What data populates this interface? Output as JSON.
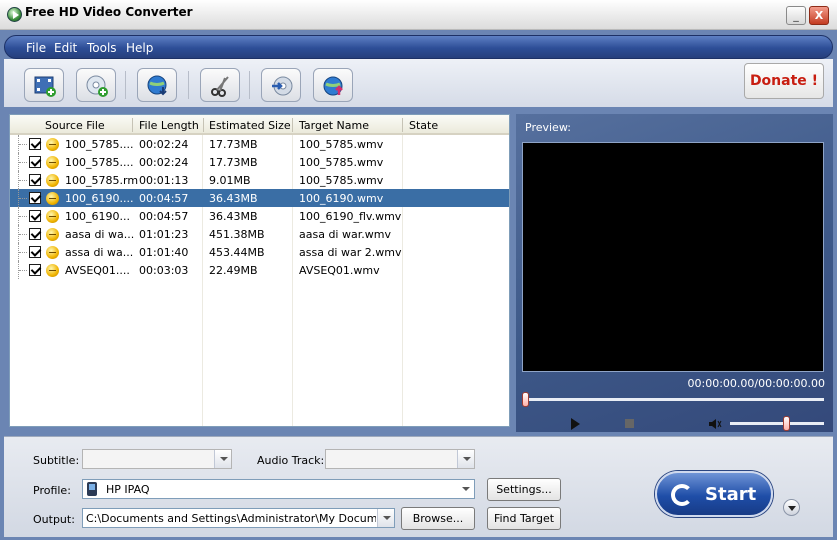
{
  "window": {
    "title": "Free HD Video Converter",
    "minimize": "_",
    "close": "X"
  },
  "menu": {
    "items": [
      "File",
      "Edit",
      "Tools",
      "Help"
    ]
  },
  "toolbar": {
    "buttons": [
      "add-video",
      "add-dvd",
      "download",
      "cut",
      "convert-disc",
      "upload"
    ],
    "donate_label": "Donate !"
  },
  "file_list": {
    "columns": [
      "Source File",
      "File Length",
      "Estimated Size",
      "Target Name",
      "State"
    ],
    "rows": [
      {
        "source": "100_5785....",
        "length": "00:02:24",
        "size": "17.73MB",
        "target": "100_5785.wmv",
        "state": "",
        "checked": true,
        "selected": false
      },
      {
        "source": "100_5785....",
        "length": "00:02:24",
        "size": "17.73MB",
        "target": "100_5785.wmv",
        "state": "",
        "checked": true,
        "selected": false
      },
      {
        "source": "100_5785.rm",
        "length": "00:01:13",
        "size": "9.01MB",
        "target": "100_5785.wmv",
        "state": "",
        "checked": true,
        "selected": false
      },
      {
        "source": "100_6190....",
        "length": "00:04:57",
        "size": "36.43MB",
        "target": "100_6190.wmv",
        "state": "",
        "checked": true,
        "selected": true
      },
      {
        "source": "100_6190...",
        "length": "00:04:57",
        "size": "36.43MB",
        "target": "100_6190_flv.wmv",
        "state": "",
        "checked": true,
        "selected": false
      },
      {
        "source": "aasa di wa...",
        "length": "01:01:23",
        "size": "451.38MB",
        "target": "aasa di war.wmv",
        "state": "",
        "checked": true,
        "selected": false
      },
      {
        "source": "assa di wa...",
        "length": "01:01:40",
        "size": "453.44MB",
        "target": "assa di war 2.wmv",
        "state": "",
        "checked": true,
        "selected": false
      },
      {
        "source": "AVSEQ01....",
        "length": "00:03:03",
        "size": "22.49MB",
        "target": "AVSEQ01.wmv",
        "state": "",
        "checked": true,
        "selected": false
      }
    ]
  },
  "preview": {
    "label": "Preview:",
    "time": "00:00:00.00/00:00:00.00",
    "seek_position": 0,
    "volume_level": 0.6
  },
  "settings": {
    "subtitle_label": "Subtitle:",
    "subtitle_value": "",
    "audio_track_label": "Audio Track:",
    "audio_track_value": "",
    "profile_label": "Profile:",
    "profile_value": "HP IPAQ",
    "output_label": "Output:",
    "output_value": "C:\\Documents and Settings\\Administrator\\My Documents\\Fre",
    "settings_button": "Settings...",
    "browse_button": "Browse...",
    "find_target_button": "Find Target",
    "start_button": "Start"
  }
}
